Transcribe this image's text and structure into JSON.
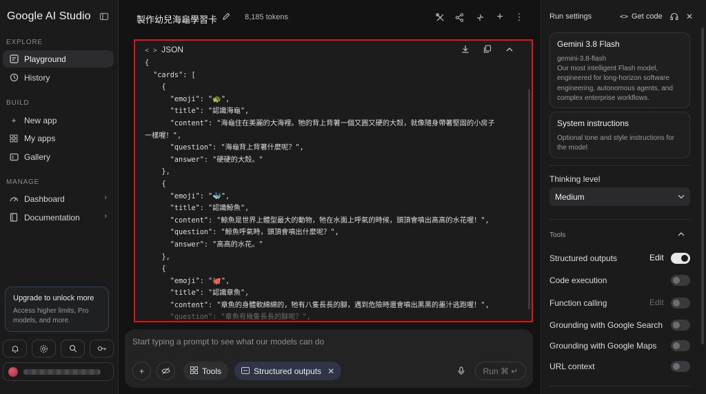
{
  "sidebar": {
    "logo": "Google AI Studio",
    "sections": [
      {
        "label": "EXPLORE",
        "items": [
          {
            "label": "Playground",
            "icon": "playground-icon",
            "active": true
          },
          {
            "label": "History",
            "icon": "history-icon"
          }
        ]
      },
      {
        "label": "BUILD",
        "items": [
          {
            "label": "New app",
            "icon": "plus-icon"
          },
          {
            "label": "My apps",
            "icon": "apps-icon"
          },
          {
            "label": "Gallery",
            "icon": "gallery-icon"
          }
        ]
      },
      {
        "label": "MANAGE",
        "items": [
          {
            "label": "Dashboard",
            "icon": "dashboard-icon"
          },
          {
            "label": "Documentation",
            "icon": "documentation-icon"
          }
        ]
      }
    ],
    "upgrade": {
      "title": "Upgrade to unlock more",
      "desc": "Access higher limits, Pro models, and more."
    }
  },
  "header": {
    "title": "製作幼兒海龜學習卡",
    "tokens": "8,185 tokens"
  },
  "json_panel": {
    "label": "JSON",
    "lines": [
      "{",
      "  \"cards\": [",
      "    {",
      "      \"emoji\": \"🐢\",",
      "      \"title\": \"認識海龜\",",
      "      \"content\": \"海龜住在美麗的大海裡。牠的背上背著一個又圓又硬的大殼，就像隨身帶著堅固的小房子",
      "一樣喔！\",",
      "      \"question\": \"海龜背上背著什麼呢？\",",
      "      \"answer\": \"硬硬的大殼。\"",
      "    },",
      "    {",
      "      \"emoji\": \"🐳\",",
      "      \"title\": \"認識鯨魚\",",
      "      \"content\": \"鯨魚是世界上體型最大的動物，牠在水面上呼氣的時候，頭頂會噴出高高的水花喔！\",",
      "      \"question\": \"鯨魚呼氣時，頭頂會噴出什麼呢？\",",
      "      \"answer\": \"高高的水花。\"",
      "    },",
      "    {",
      "      \"emoji\": \"🐙\",",
      "      \"title\": \"認識章魚\",",
      "      \"content\": \"章魚的身體軟綿綿的，牠有八隻長長的腳，遇到危險時還會噴出黑黑的墨汁逃跑喔！\",",
      "      \"question\": \"章魚有幾隻長長的腳呢？\","
    ]
  },
  "prompt": {
    "placeholder": "Start typing a prompt to see what our models can do",
    "tools_label": "Tools",
    "chip_label": "Structured outputs",
    "run_label": "Run ⌘ ↵"
  },
  "right_panel": {
    "title": "Run settings",
    "get_code": "Get code",
    "model": {
      "name": "Gemini 3.8 Flash",
      "id": "gemini-3.8-flash",
      "desc": "Our most intelligent Flash model, engineered for long-horizon software engineering, autonomous agents, and complex enterprise workflows."
    },
    "system": {
      "title": "System instructions",
      "desc": "Optional tone and style instructions for the model"
    },
    "thinking_label": "Thinking level",
    "thinking_value": "Medium",
    "tools_label": "Tools",
    "tools": [
      {
        "name": "Structured outputs",
        "edit": "Edit",
        "on": true
      },
      {
        "name": "Code execution",
        "on": false
      },
      {
        "name": "Function calling",
        "edit": "Edit",
        "on": false
      },
      {
        "name": "Grounding with Google Search",
        "on": false
      },
      {
        "name": "Grounding with Google Maps",
        "on": false
      },
      {
        "name": "URL context",
        "on": false
      }
    ]
  }
}
